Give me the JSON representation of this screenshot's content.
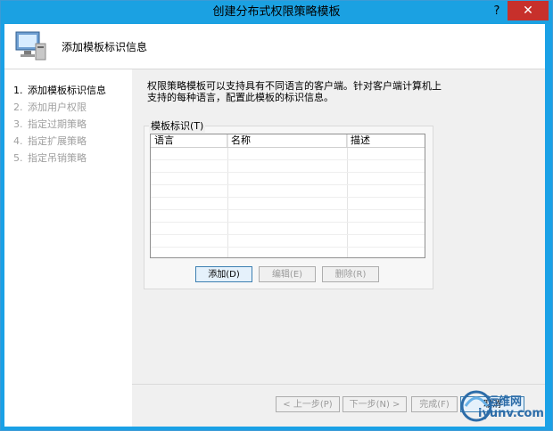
{
  "window": {
    "title": "创建分布式权限策略模板",
    "help_symbol": "?",
    "close_symbol": "✕"
  },
  "header": {
    "title": "添加模板标识信息",
    "icon": "computer-icon"
  },
  "nav": {
    "items": [
      {
        "num": "1.",
        "label": "添加模板标识信息",
        "state": "active"
      },
      {
        "num": "2.",
        "label": "添加用户权限",
        "state": "disabled"
      },
      {
        "num": "3.",
        "label": "指定过期策略",
        "state": "disabled"
      },
      {
        "num": "4.",
        "label": "指定扩展策略",
        "state": "disabled"
      },
      {
        "num": "5.",
        "label": "指定吊销策略",
        "state": "disabled"
      }
    ]
  },
  "main": {
    "description_line1": "权限策略模板可以支持具有不同语言的客户端。针对客户端计算机上",
    "description_line2": "支持的每种语言，配置此模板的标识信息。",
    "group_label": "模板标识(T)",
    "table": {
      "columns": [
        "语言",
        "名称",
        "描述"
      ],
      "rows": []
    },
    "buttons": {
      "add": "添加(D)",
      "edit": "编辑(E)",
      "delete": "删除(R)"
    }
  },
  "footer": {
    "prev": "< 上一步(P)",
    "next": "下一步(N) >",
    "finish": "完成(F)",
    "cancel": "取消"
  },
  "watermark": {
    "line1": "运维网",
    "line2": "iyunv.com"
  },
  "colors": {
    "titlebar": "#1ba1e2",
    "close": "#c7302b",
    "accent": "#3c7fb1"
  }
}
